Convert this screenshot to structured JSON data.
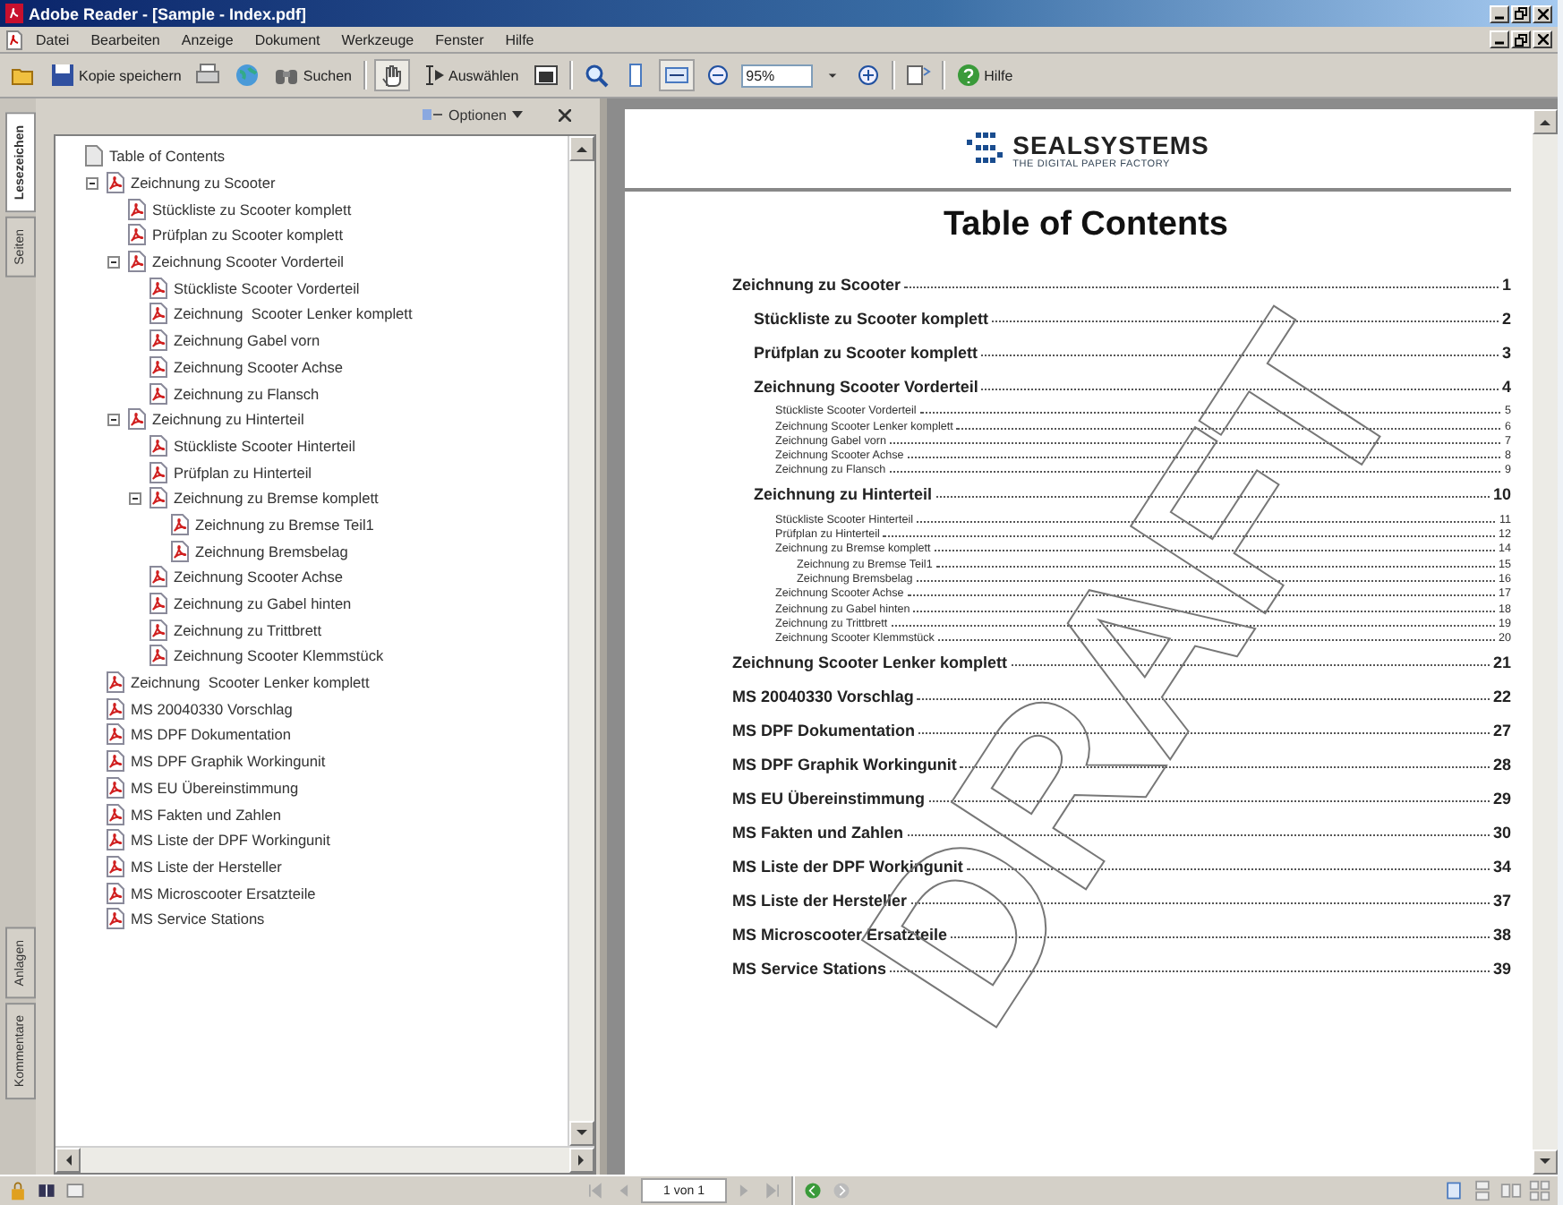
{
  "window": {
    "title": "Adobe Reader - [Sample - Index.pdf]"
  },
  "menu": [
    "Datei",
    "Bearbeiten",
    "Anzeige",
    "Dokument",
    "Werkzeuge",
    "Fenster",
    "Hilfe"
  ],
  "toolbar": {
    "save_label": "Kopie speichern",
    "search_label": "Suchen",
    "select_label": "Auswählen",
    "zoom": "95%",
    "help_label": "Hilfe"
  },
  "side_tabs": [
    {
      "label": "Lesezeichen",
      "selected": true
    },
    {
      "label": "Seiten",
      "selected": false
    }
  ],
  "side_tabs_bottom": [
    {
      "label": "Anlagen",
      "selected": false
    },
    {
      "label": "Kommentare",
      "selected": false
    }
  ],
  "bookmarks": {
    "options_label": "Optionen",
    "root": "Table of Contents",
    "items": [
      {
        "label": "Zeichnung zu Scooter",
        "expanded": true,
        "children": [
          {
            "label": "Stückliste zu Scooter komplett"
          },
          {
            "label": "Prüfplan zu Scooter komplett"
          },
          {
            "label": "Zeichnung Scooter Vorderteil",
            "expanded": true,
            "children": [
              {
                "label": "Stückliste Scooter Vorderteil"
              },
              {
                "label": "Zeichnung  Scooter Lenker komplett"
              },
              {
                "label": "Zeichnung Gabel vorn"
              },
              {
                "label": "Zeichnung Scooter Achse"
              },
              {
                "label": "Zeichnung zu Flansch"
              }
            ]
          },
          {
            "label": "Zeichnung zu Hinterteil",
            "expanded": true,
            "children": [
              {
                "label": "Stückliste Scooter Hinterteil"
              },
              {
                "label": "Prüfplan zu Hinterteil"
              },
              {
                "label": "Zeichnung zu Bremse komplett",
                "expanded": true,
                "children": [
                  {
                    "label": "Zeichnung zu Bremse Teil1"
                  },
                  {
                    "label": "Zeichnung Bremsbelag"
                  }
                ]
              },
              {
                "label": "Zeichnung Scooter Achse"
              },
              {
                "label": "Zeichnung zu Gabel hinten"
              },
              {
                "label": "Zeichnung zu Trittbrett"
              },
              {
                "label": "Zeichnung Scooter Klemmstück"
              }
            ]
          }
        ]
      },
      {
        "label": "Zeichnung  Scooter Lenker komplett"
      },
      {
        "label": "MS 20040330 Vorschlag"
      },
      {
        "label": "MS DPF Dokumentation"
      },
      {
        "label": "MS DPF Graphik Workingunit"
      },
      {
        "label": "MS EU Übereinstimmung"
      },
      {
        "label": "MS Fakten und Zahlen"
      },
      {
        "label": "MS Liste der DPF Workingunit"
      },
      {
        "label": "MS Liste der Hersteller"
      },
      {
        "label": "MS Microscooter Ersatzteile"
      },
      {
        "label": "MS Service Stations"
      }
    ]
  },
  "document": {
    "logo_name": "SEALSYSTEMS",
    "logo_tagline": "THE DIGITAL PAPER FACTORY",
    "title": "Table of Contents",
    "stamp": "DRAFT",
    "toc": [
      {
        "label": "Zeichnung zu Scooter",
        "page": "1",
        "children": [
          {
            "label": "Stückliste zu Scooter komplett",
            "page": "2"
          },
          {
            "label": "Prüfplan zu Scooter komplett",
            "page": "3"
          },
          {
            "label": "Zeichnung Scooter Vorderteil",
            "page": "4",
            "children": [
              {
                "label": "Stückliste Scooter Vorderteil",
                "page": "5"
              },
              {
                "label": "Zeichnung Scooter Lenker komplett",
                "page": "6"
              },
              {
                "label": "Zeichnung Gabel vorn",
                "page": "7"
              },
              {
                "label": "Zeichnung Scooter Achse",
                "page": "8"
              },
              {
                "label": "Zeichnung zu Flansch",
                "page": "9"
              }
            ]
          },
          {
            "label": "Zeichnung zu Hinterteil",
            "page": "10",
            "children": [
              {
                "label": "Stückliste Scooter Hinterteil",
                "page": "11"
              },
              {
                "label": "Prüfplan zu Hinterteil",
                "page": "12"
              },
              {
                "label": "Zeichnung zu Bremse komplett",
                "page": "14",
                "children": [
                  {
                    "label": "Zeichnung zu Bremse Teil1",
                    "page": "15"
                  },
                  {
                    "label": "Zeichnung Bremsbelag",
                    "page": "16"
                  }
                ]
              },
              {
                "label": "Zeichnung Scooter Achse",
                "page": "17"
              },
              {
                "label": "Zeichnung zu Gabel hinten",
                "page": "18"
              },
              {
                "label": "Zeichnung zu Trittbrett",
                "page": "19"
              },
              {
                "label": "Zeichnung Scooter Klemmstück",
                "page": "20"
              }
            ]
          }
        ]
      },
      {
        "label": "Zeichnung Scooter Lenker komplett",
        "page": "21"
      },
      {
        "label": "MS 20040330 Vorschlag",
        "page": "22"
      },
      {
        "label": "MS DPF Dokumentation",
        "page": "27"
      },
      {
        "label": "MS DPF Graphik Workingunit",
        "page": "28"
      },
      {
        "label": "MS EU Übereinstimmung",
        "page": "29"
      },
      {
        "label": "MS Fakten und Zahlen",
        "page": "30"
      },
      {
        "label": "MS Liste der DPF Workingunit",
        "page": "34"
      },
      {
        "label": "MS Liste der Hersteller",
        "page": "37"
      },
      {
        "label": "MS Microscooter Ersatzteile",
        "page": "38"
      },
      {
        "label": "MS Service Stations",
        "page": "39"
      }
    ]
  },
  "status_bar": {
    "page_field": "1 von 1"
  }
}
